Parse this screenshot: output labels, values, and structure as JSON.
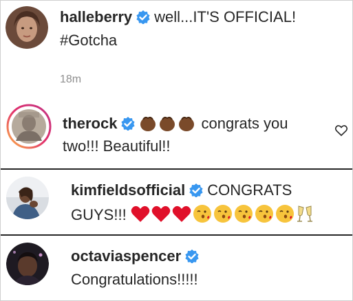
{
  "comments": [
    {
      "username": "halleberry",
      "text_line1": "well...IT'S OFFICIAL!",
      "text_line2": "#Gotcha",
      "time": "18m"
    },
    {
      "username": "therock",
      "text_line1": "congrats you",
      "text_line2": "two!!! Beautiful!!",
      "emoji": "clapping-hands-dark x3"
    },
    {
      "username": "kimfieldsofficial",
      "text_line1": "CONGRATS",
      "text_line2": "GUYS!!!",
      "emoji": "red-heart x3, face-blowing-kiss x5, clinking-glasses"
    },
    {
      "username": "octaviaspencer",
      "text_line1": "Congratulations!!!!!"
    }
  ],
  "colors": {
    "verified_blue": "#3897f0",
    "heart_red": "#e0102a",
    "timestamp_gray": "#8e8e8e",
    "story_ring": "#d6249f"
  }
}
